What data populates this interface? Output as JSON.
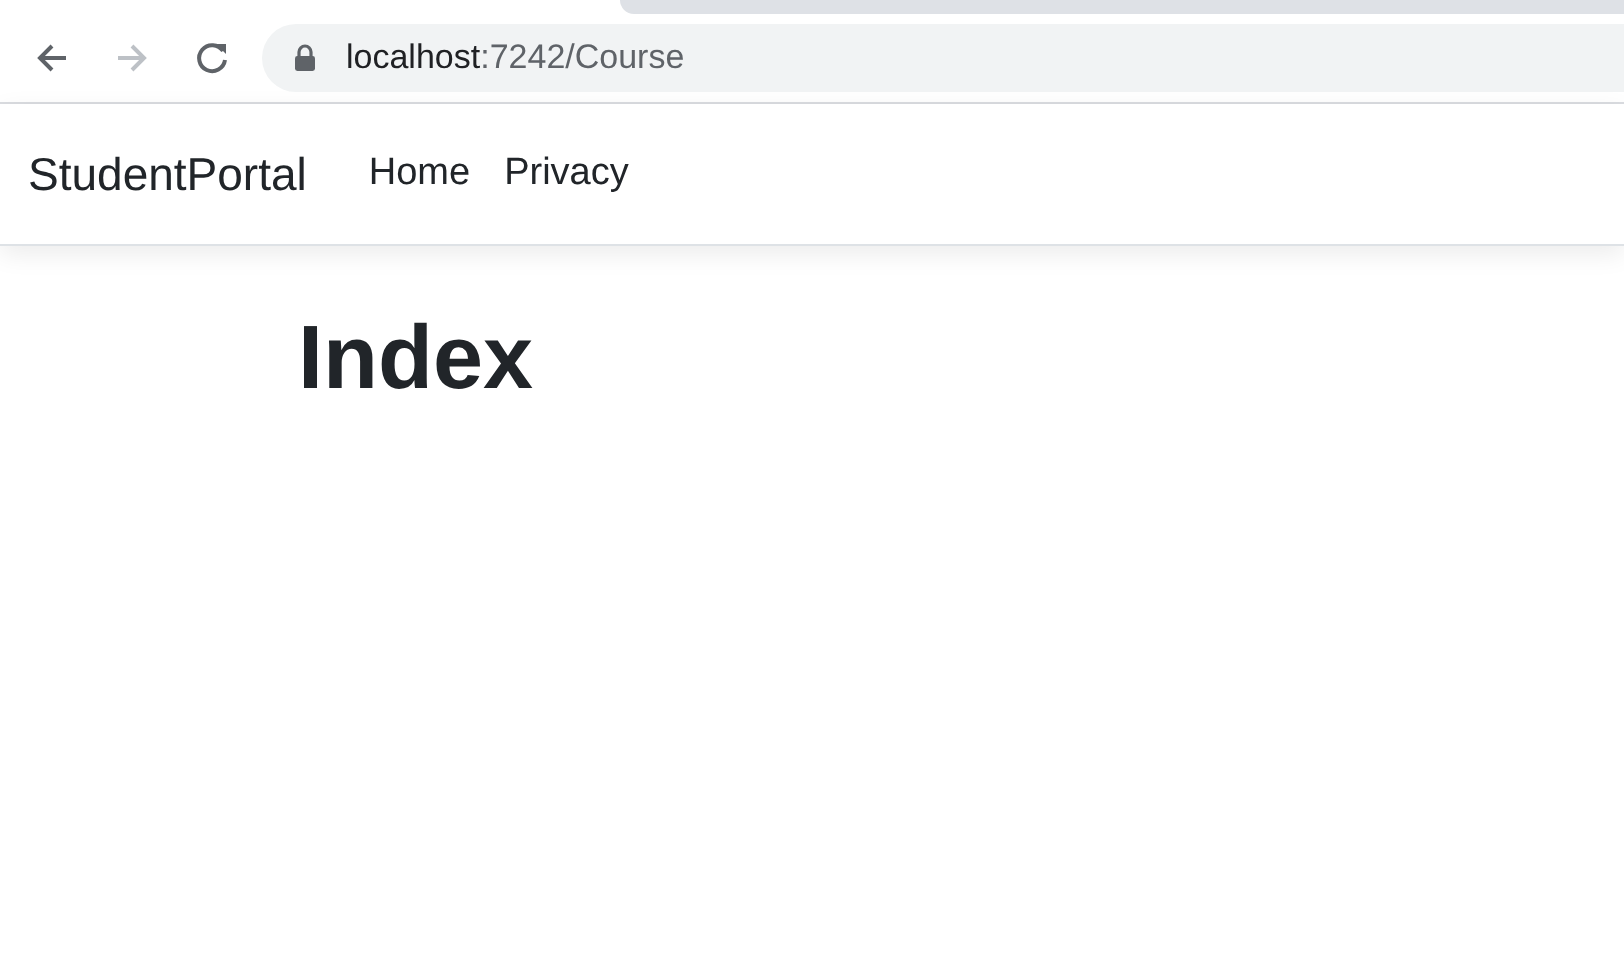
{
  "browser": {
    "back": {
      "disabled": false
    },
    "forward": {
      "disabled": true
    },
    "url": {
      "host": "localhost",
      "path": ":7242/Course"
    }
  },
  "navbar": {
    "brand": "StudentPortal",
    "links": [
      {
        "label": "Home"
      },
      {
        "label": "Privacy"
      }
    ]
  },
  "heading": "Index"
}
